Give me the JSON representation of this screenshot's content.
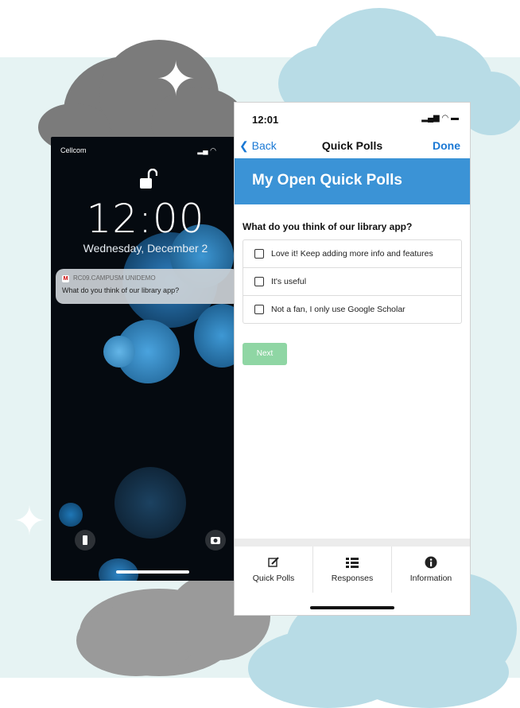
{
  "lock_screen": {
    "carrier": "Cellcom",
    "time": "12:00",
    "date": "Wednesday, December 2",
    "notification": {
      "app_name": "RC09.CAMPUSM UNIDEMO",
      "message": "What do you think of our library app?"
    }
  },
  "app": {
    "status_time": "12:01",
    "nav": {
      "back_label": "Back",
      "title": "Quick Polls",
      "done_label": "Done"
    },
    "header_title": "My Open Quick Polls",
    "question": "What do you think of our library app?",
    "options": [
      "Love it! Keep adding more info and features",
      "It's useful",
      "Not a fan, I only use Google Scholar"
    ],
    "next_label": "Next",
    "tabs": [
      {
        "label": "Quick Polls",
        "icon": "edit-icon"
      },
      {
        "label": "Responses",
        "icon": "list-icon"
      },
      {
        "label": "Information",
        "icon": "info-icon"
      }
    ]
  },
  "colors": {
    "header_blue": "#3b93d6",
    "ios_blue": "#1a78d4",
    "next_green": "#8fd6a4",
    "background_mint": "#e6f3f3",
    "cloud_light": "#b8dce6",
    "cloud_dark": "#7b7b7b"
  }
}
